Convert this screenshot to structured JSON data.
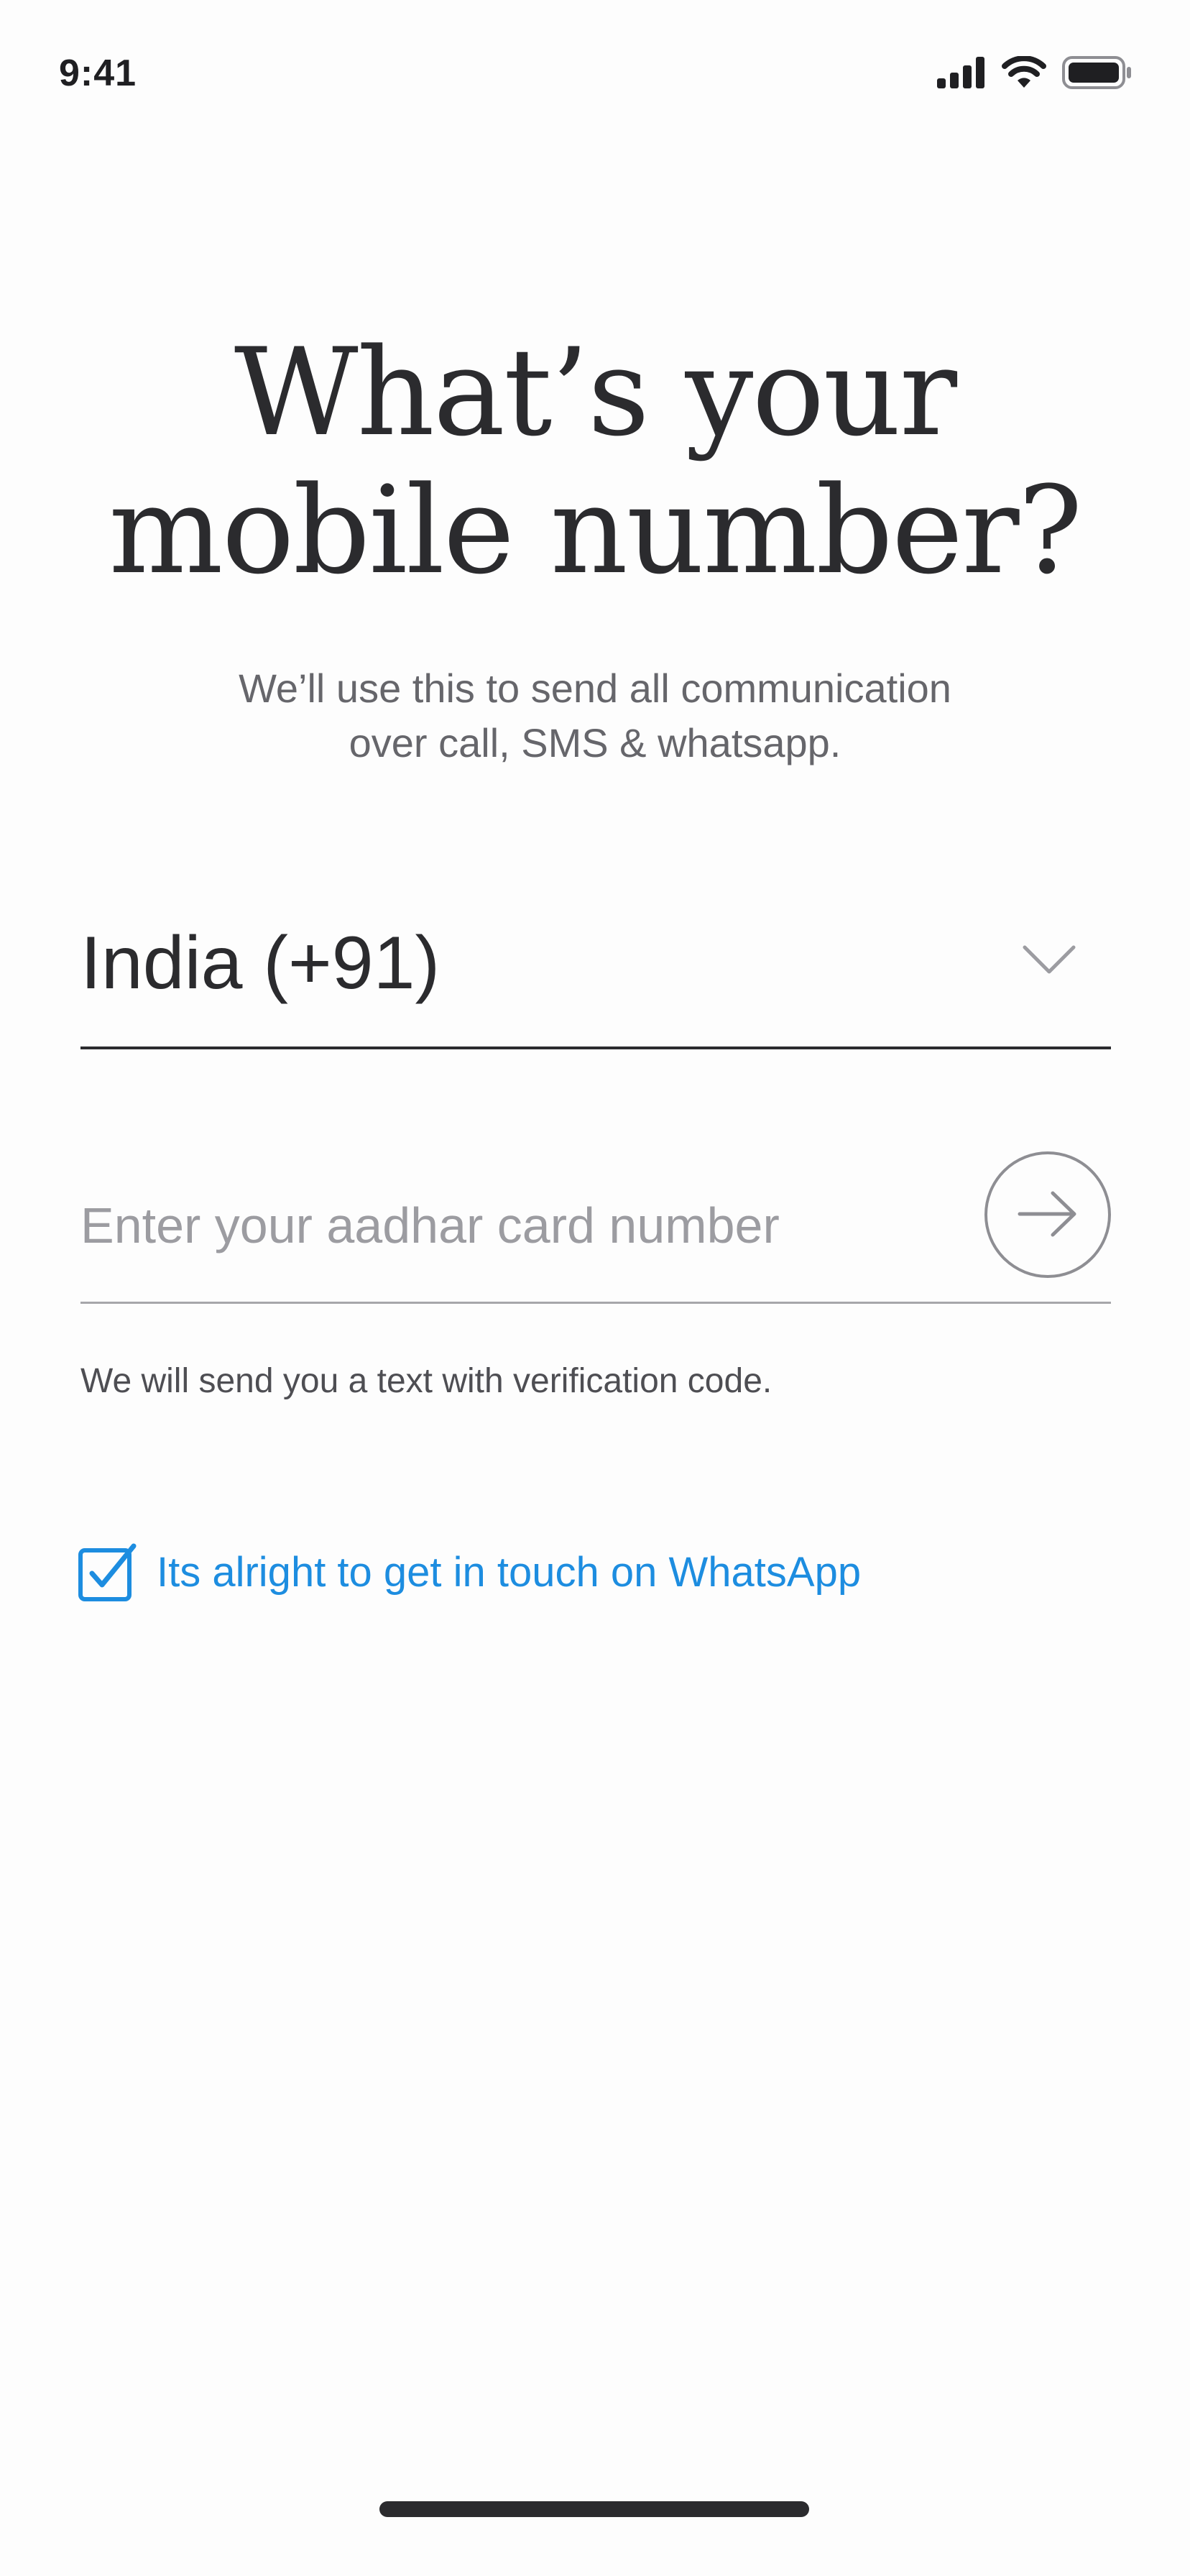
{
  "status_bar": {
    "time": "9:41",
    "icons": [
      "cellular-signal-icon",
      "wifi-icon",
      "battery-icon"
    ]
  },
  "header": {
    "title_line1": "What’s your",
    "title_line2": "mobile number?",
    "subtitle_line1": "We’ll use this to send all communication",
    "subtitle_line2": "over call, SMS & whatsapp."
  },
  "country_select": {
    "value": "India (+91)",
    "icon": "chevron-down-icon"
  },
  "aadhar_field": {
    "value": "",
    "placeholder": "Enter your aadhar card number",
    "submit_icon": "arrow-right-icon"
  },
  "helper_text": "We will send you a  text with verification code.",
  "whatsapp_consent": {
    "label": "Its alright to get in touch on WhatsApp",
    "checked": true,
    "icon": "checkbox-checked-icon"
  },
  "colors": {
    "text_primary": "#2b2b2e",
    "text_secondary": "#66666b",
    "placeholder": "#9c9ca1",
    "accent": "#1d8de0",
    "background": "#fdfdfd"
  }
}
